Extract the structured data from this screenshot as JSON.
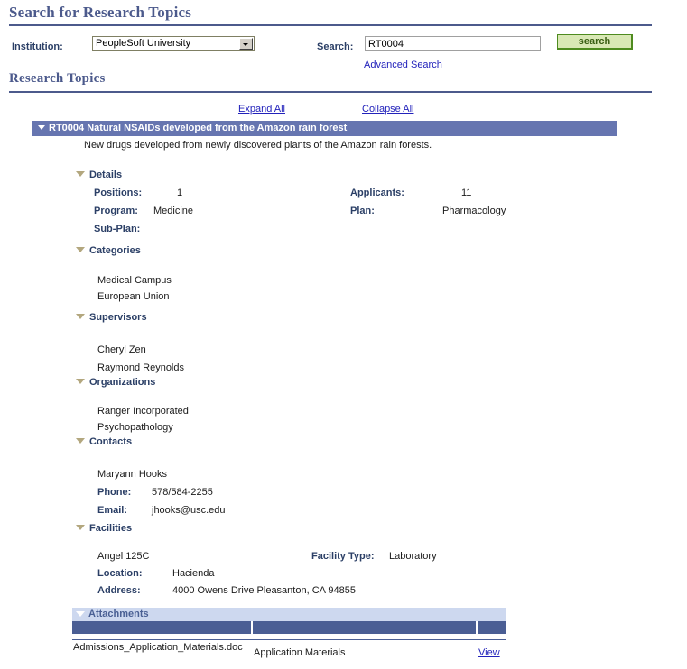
{
  "page": {
    "title": "Search for Research Topics",
    "section_title": "Research Topics"
  },
  "search_bar": {
    "institution_label": "Institution:",
    "institution_value": "PeopleSoft University",
    "search_label": "Search:",
    "search_value": "RT0004",
    "search_placeholder": "",
    "search_button_label": "search",
    "advanced_search_label": "Advanced Search"
  },
  "list_controls": {
    "expand_all": "Expand All",
    "collapse_all": "Collapse All"
  },
  "topic": {
    "band_title": "RT0004 Natural NSAIDs developed from the Amazon rain forest",
    "description": "New drugs developed from newly discovered plants of the Amazon rain forests."
  },
  "details": {
    "heading": "Details",
    "positions_label": "Positions:",
    "positions_value": "1",
    "applicants_label": "Applicants:",
    "applicants_value": "11",
    "program_label": "Program:",
    "program_value": "Medicine",
    "plan_label": "Plan:",
    "plan_value": "Pharmacology",
    "subplan_label": "Sub-Plan:",
    "subplan_value": ""
  },
  "categories": {
    "heading": "Categories",
    "items": [
      "Medical Campus",
      "European Union"
    ]
  },
  "supervisors": {
    "heading": "Supervisors",
    "items": [
      "Cheryl Zen",
      "Raymond Reynolds"
    ]
  },
  "organizations": {
    "heading": "Organizations",
    "items": [
      "Ranger Incorporated",
      "Psychopathology"
    ]
  },
  "contacts": {
    "heading": "Contacts",
    "name": "Maryann Hooks",
    "phone_label": "Phone:",
    "phone_value": "578/584-2255",
    "email_label": "Email:",
    "email_value": "jhooks@usc.edu"
  },
  "facilities": {
    "heading": "Facilities",
    "name": "Angel 125C",
    "facility_type_label": "Facility Type:",
    "facility_type_value": "Laboratory",
    "location_label": "Location:",
    "location_value": "Hacienda",
    "address_label": "Address:",
    "address_value": "4000 Owens Drive Pleasanton, CA 94855"
  },
  "attachments": {
    "heading": "Attachments",
    "columns": [
      "",
      "",
      ""
    ],
    "rows": [
      {
        "file_name": "Admissions_Application_Materials.doc",
        "description": "Application Materials",
        "action": "View"
      }
    ]
  },
  "colors": {
    "accent_blue": "#4c5a8c",
    "band_blue": "#6675b0",
    "label_blue": "#2b3f66",
    "link_blue": "#2222bb",
    "button_green_bg": "#d9e8b5",
    "button_green_border": "#4e8b1f",
    "attach_head_bg": "#cdd8ef",
    "attach_col_bg": "#4a5e94"
  }
}
